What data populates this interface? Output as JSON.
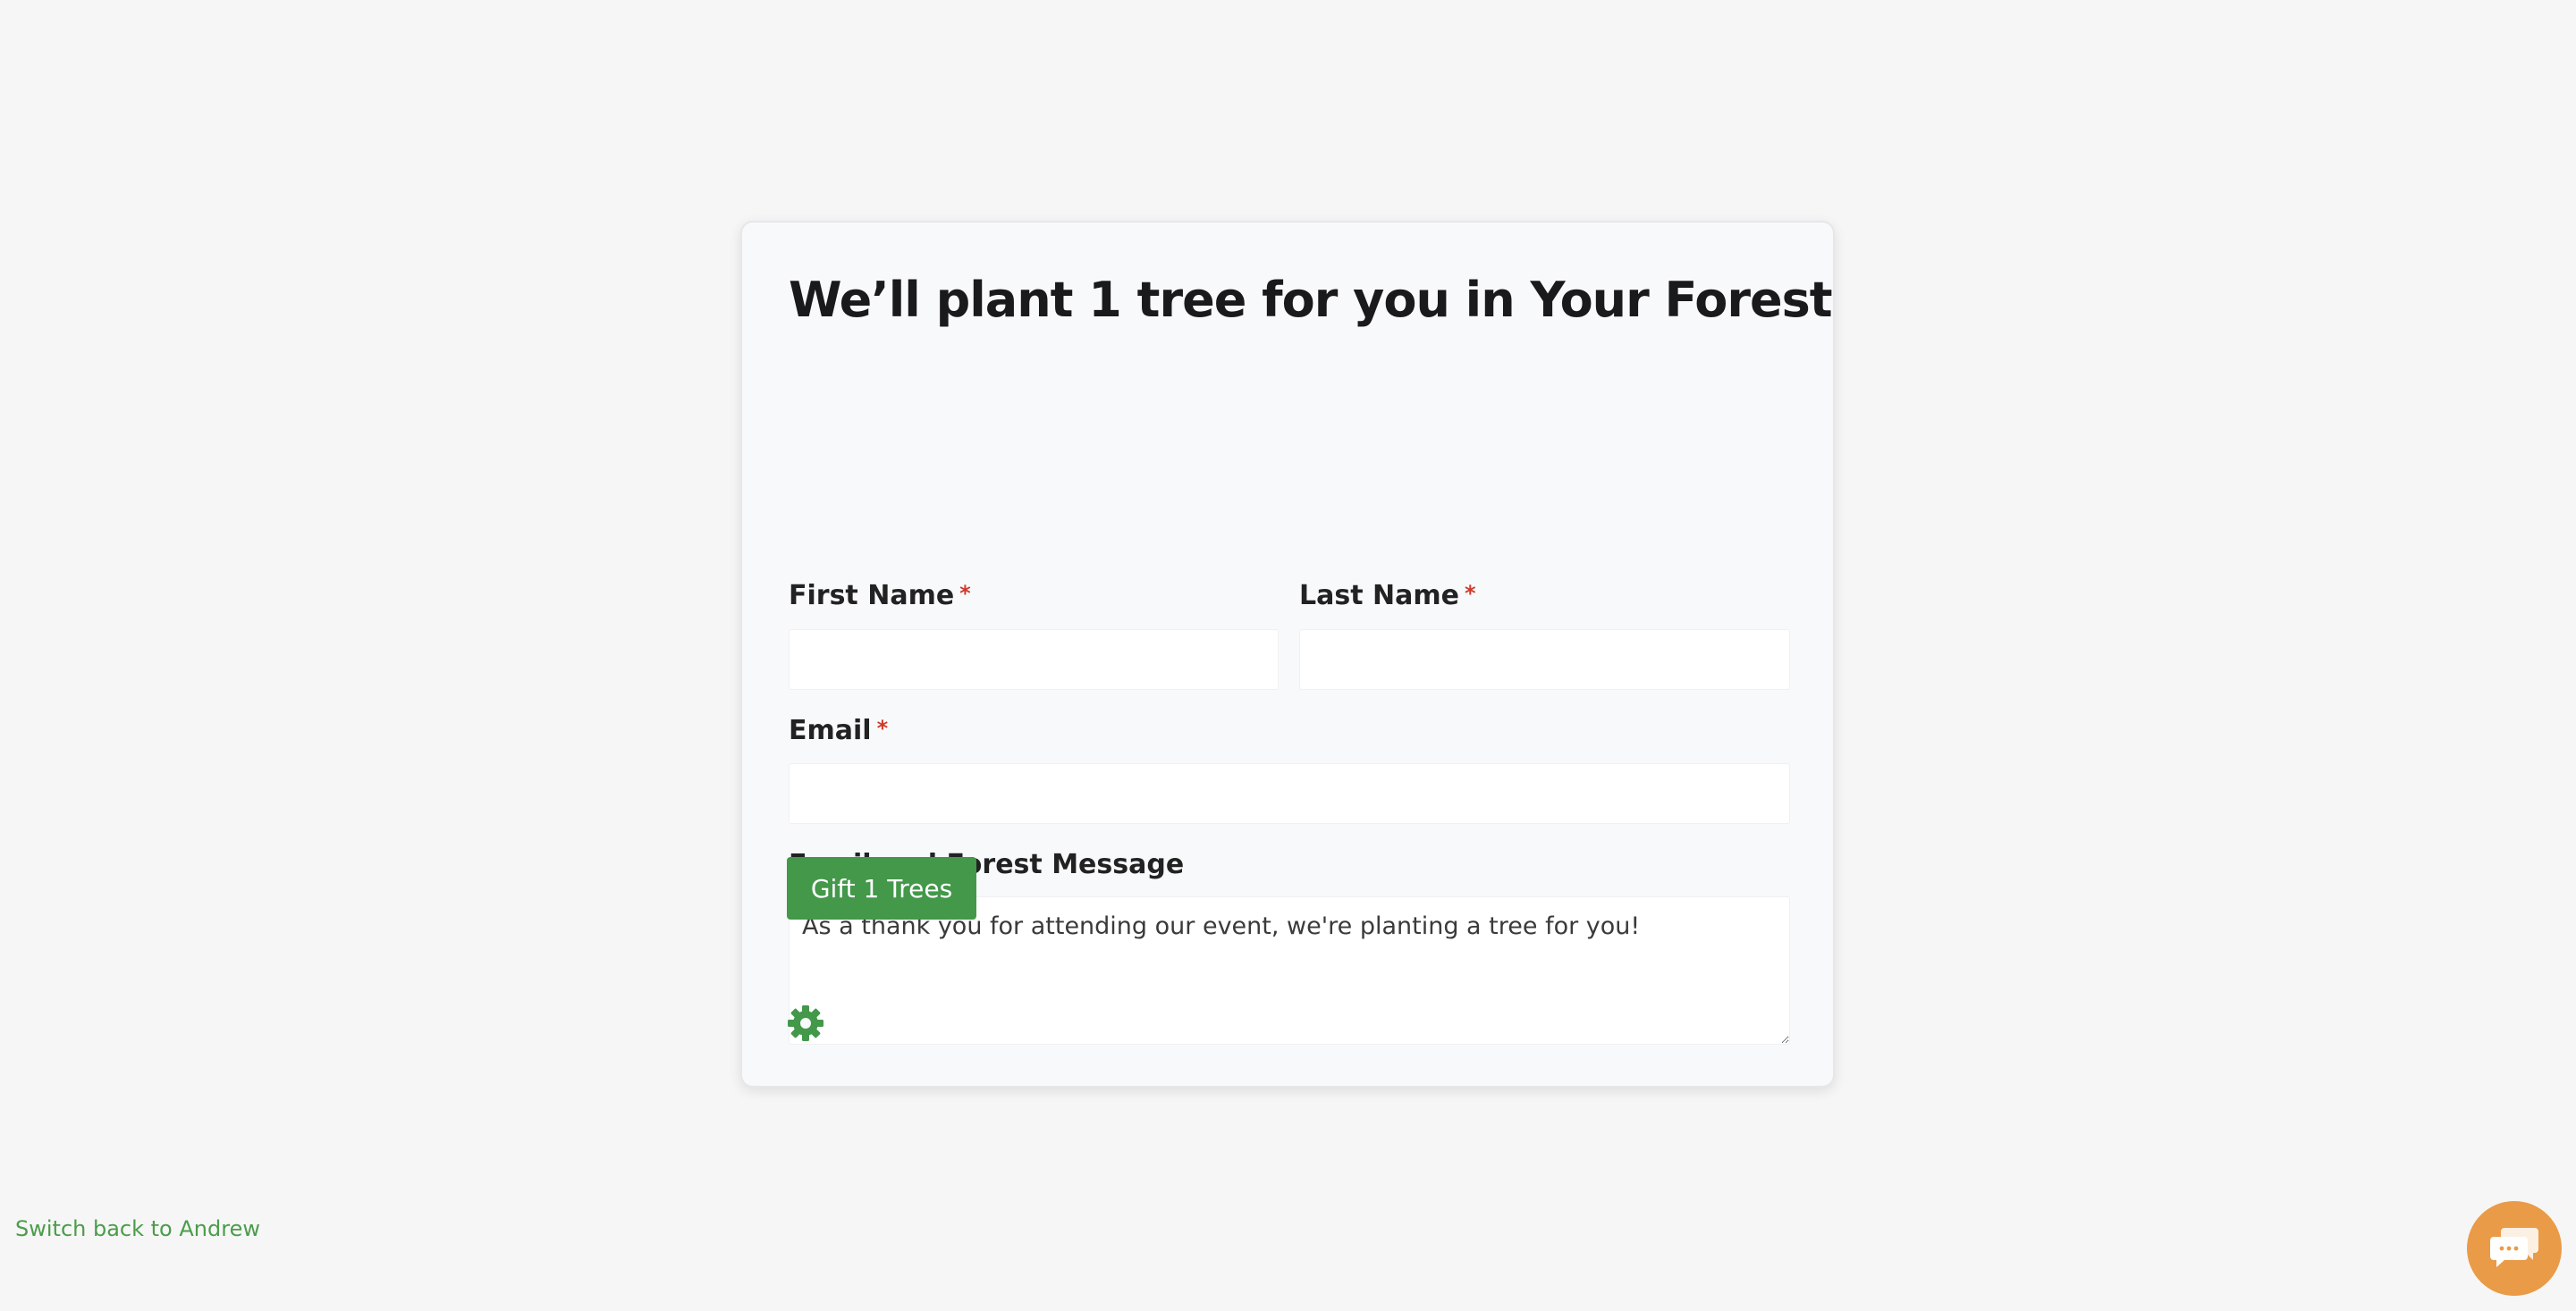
{
  "form": {
    "title": "We’ll plant 1 tree for you in Your Forest",
    "first_name": {
      "label": "First Name",
      "required_mark": "*",
      "value": ""
    },
    "last_name": {
      "label": "Last Name",
      "required_mark": "*",
      "value": ""
    },
    "email": {
      "label": "Email",
      "required_mark": "*",
      "value": ""
    },
    "message": {
      "label": "Email and Forest Message",
      "value": "As a thank you for attending our event, we're planting a tree for you!"
    },
    "submit_label": "Gift 1 Trees",
    "settings_icon": "gear-icon"
  },
  "footer": {
    "switch_link": "Switch back to Andrew"
  },
  "chat": {
    "icon": "chat-icon"
  },
  "colors": {
    "accent_green": "#43984a",
    "link_green": "#4a9d4a",
    "required_red": "#d0392b",
    "chat_orange": "#ea9b47",
    "background": "#f6f6f6"
  }
}
